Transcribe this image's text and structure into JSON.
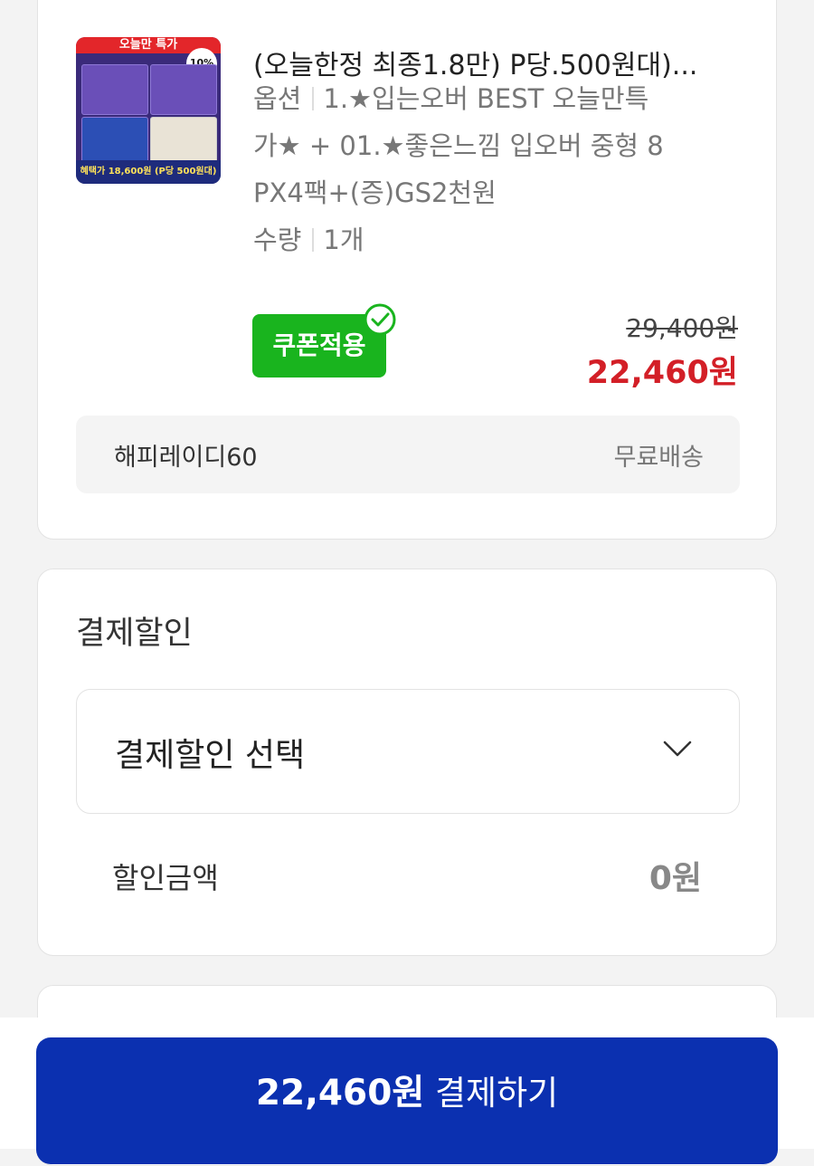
{
  "product": {
    "thumbnail": {
      "banner_text": "오늘만 특가",
      "badge_text": "10%",
      "bottom_text": "혜택가 18,600원 (P당 500원대)"
    },
    "title": "(오늘한정 최종1.8만) P당.500원대)...",
    "option_label": "옵션",
    "option_lines": [
      "1.★입는오버 BEST 오늘만특",
      "가★ + 01.★좋은느낌 입오버 중형 8",
      "PX4팩+(증)GS2천원"
    ],
    "quantity_label": "수량",
    "quantity_value": "1개",
    "coupon_label": "쿠폰적용",
    "original_price": "29,400원",
    "sale_price": "22,460원",
    "seller": "해피레이디60",
    "shipping": "무료배송"
  },
  "discount": {
    "section_title": "결제할인",
    "select_label": "결제할인 선택",
    "amount_label": "할인금액",
    "amount_value": "0원"
  },
  "pay_button": {
    "price": "22,460원",
    "action": "결제하기"
  },
  "colors": {
    "accent_blue": "#0b30b0",
    "sale_red": "#d31f27",
    "coupon_green": "#19b41e"
  }
}
